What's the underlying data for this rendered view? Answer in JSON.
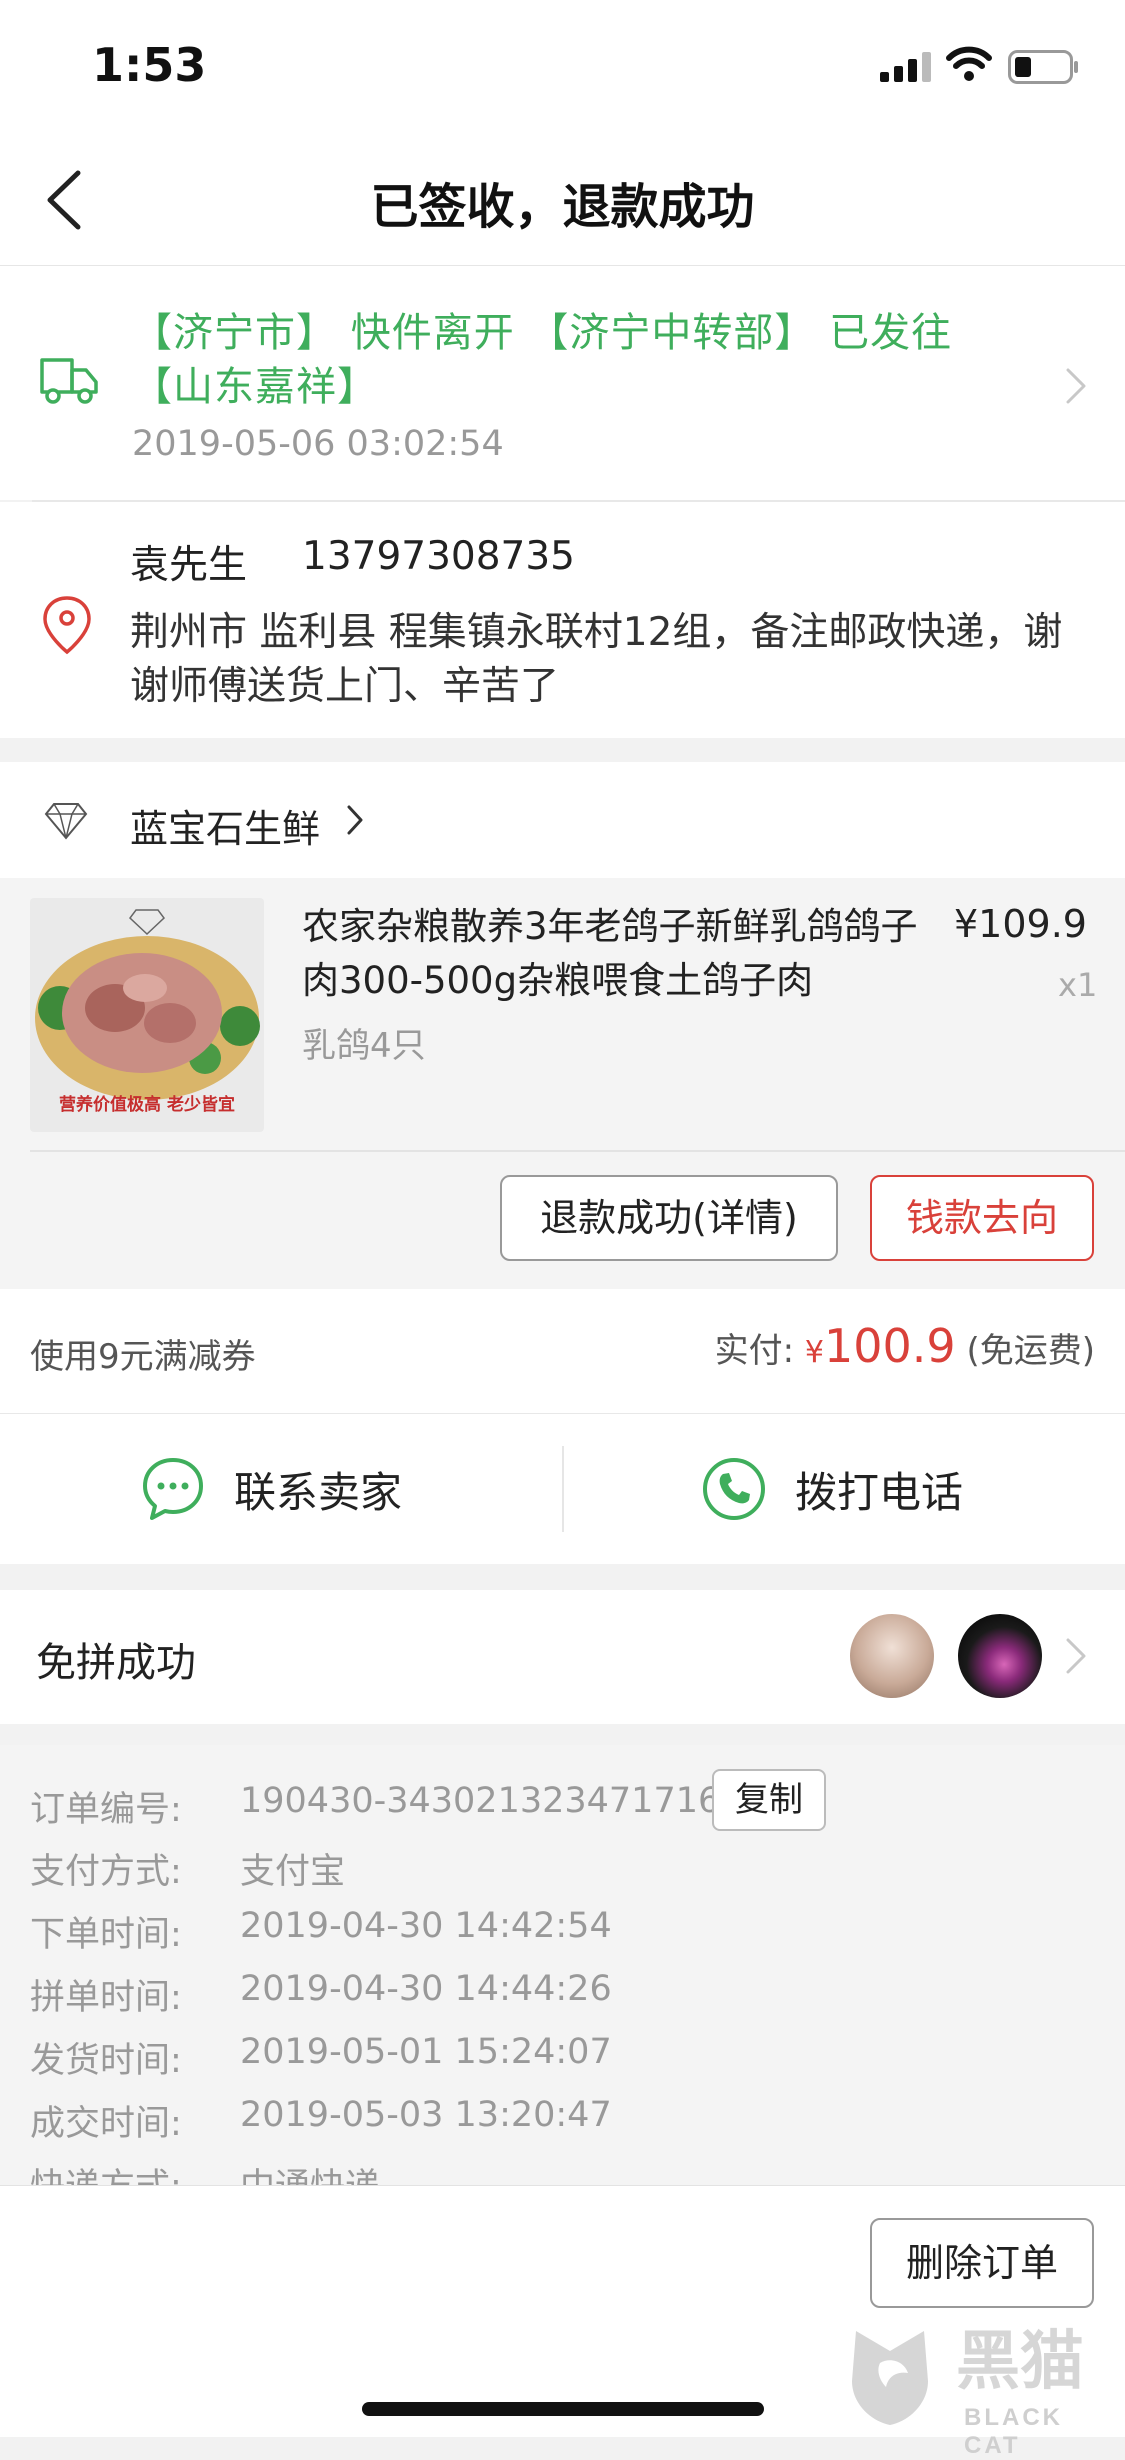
{
  "status_bar": {
    "time": "1:53"
  },
  "nav": {
    "title": "已签收，退款成功"
  },
  "logistics": {
    "text": "【济宁市】 快件离开 【济宁中转部】 已发往【山东嘉祥】",
    "time": "2019-05-06 03:02:54"
  },
  "address": {
    "name": "袁先生",
    "phone": "13797308735",
    "detail": "荆州市 监利县 程集镇永联村12组，备注邮政快递，谢谢师傅送货上门、辛苦了"
  },
  "shop": {
    "name": "蓝宝石生鲜"
  },
  "product": {
    "title": "农家杂粮散养3年老鸽子新鲜乳鸽鸽子肉300-500g杂粮喂食土鸽子肉",
    "price": "¥109.9",
    "qty": "x1",
    "variant": "乳鸽4只",
    "image_text": "营养价值极高 老少皆宜",
    "refund_detail_label": "退款成功(详情)",
    "money_flow_label": "钱款去向"
  },
  "payment": {
    "coupon": "使用9元满减券",
    "paid_label": "实付:",
    "currency": "¥",
    "amount": "100.9",
    "shipping_note": "(免运费)"
  },
  "contact": {
    "seller_label": "联系卖家",
    "call_label": "拨打电话"
  },
  "group": {
    "title": "免拼成功"
  },
  "order_info": {
    "order_no_label": "订单编号:",
    "order_no": "190430-343021323471716",
    "copy_label": "复制",
    "rows": [
      {
        "label": "支付方式:",
        "value": "支付宝"
      },
      {
        "label": "下单时间:",
        "value": "2019-04-30 14:42:54"
      },
      {
        "label": "拼单时间:",
        "value": "2019-04-30 14:44:26"
      },
      {
        "label": "发货时间:",
        "value": "2019-05-01 15:24:07"
      },
      {
        "label": "成交时间:",
        "value": "2019-05-03 13:20:47"
      },
      {
        "label": "快递方式:",
        "value": "中通快递"
      }
    ]
  },
  "bottom": {
    "delete_label": "删除订单"
  },
  "watermark": {
    "text": "BLACK CAT",
    "cn": "黑猫"
  },
  "colors": {
    "green": "#3fae5c",
    "red": "#d9413a",
    "gray": "#999999"
  },
  "icons": [
    "signal-icon",
    "wifi-icon",
    "battery-icon",
    "back-chevron-icon",
    "truck-icon",
    "location-pin-icon",
    "diamond-logo-icon",
    "chat-bubble-icon",
    "phone-icon",
    "chevron-right-icon"
  ]
}
